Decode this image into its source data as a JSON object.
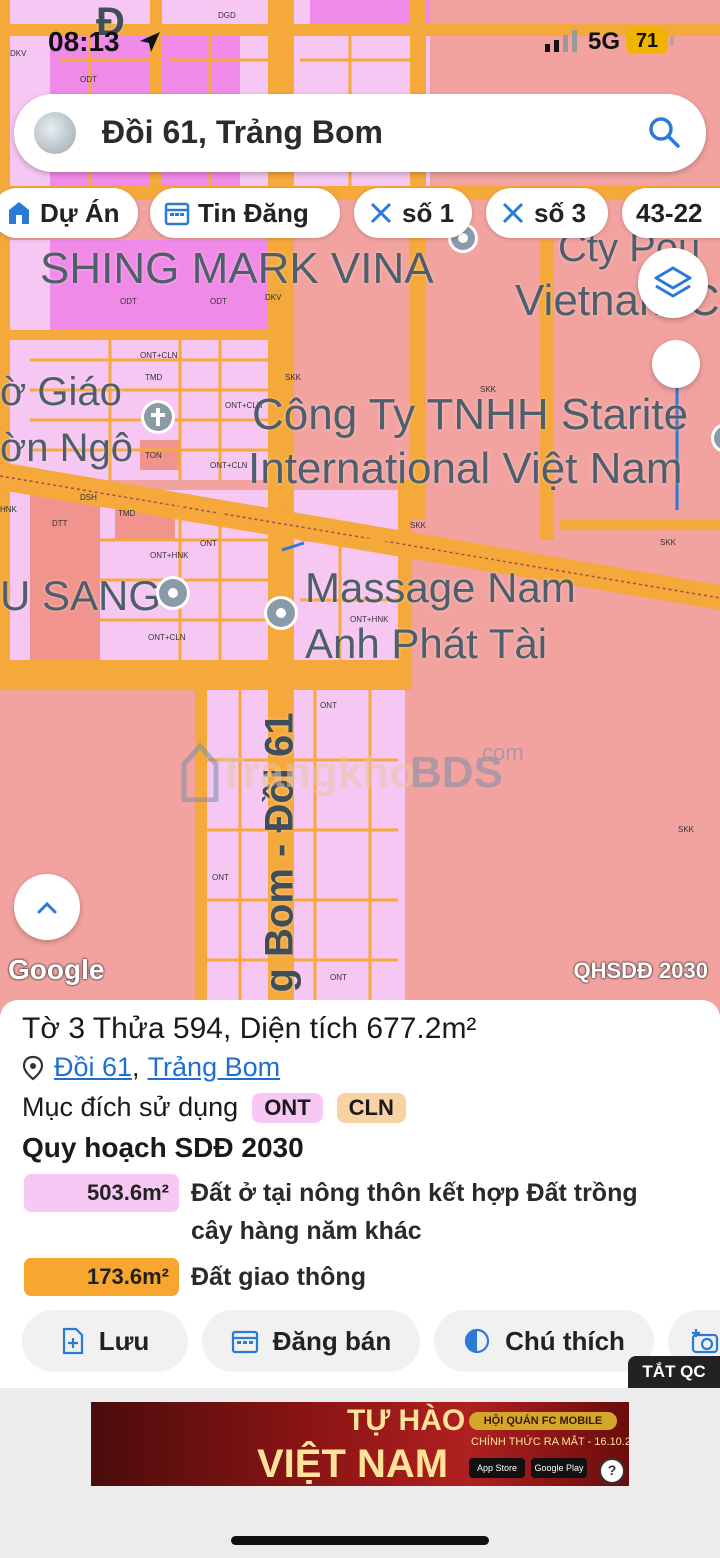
{
  "status_bar": {
    "time": "08:13",
    "network": "5G",
    "battery": "71"
  },
  "search": {
    "query": "Đồi 61, Trảng Bom"
  },
  "chips": [
    "Dự Án",
    "Tin Đăng",
    "số 1",
    "số 3",
    "43-22"
  ],
  "map": {
    "labels": {
      "shing": "SHING MARK VINA",
      "cty_pou": "Cty Pou",
      "vietnam_c": "Vietnam C",
      "giao": "ờ Giáo",
      "ngo": "ờn Ngô",
      "starite1": "Công Ty TNHH Starite",
      "starite2": "International Việt Nam",
      "sang": "U SANG",
      "massage1": "Massage Nam",
      "massage2": "Anh Phát Tài",
      "road": "g Bom - Đồi 61",
      "top_road": "Đ"
    },
    "parcel_codes": [
      "ODT",
      "DGD",
      "DKV",
      "SKK",
      "ONT+CLN",
      "TMD",
      "DVH",
      "DTT",
      "DSH",
      "TON",
      "HNK",
      "ONT",
      "ONT+HNK"
    ],
    "watermark": {
      "text": "Trangkho",
      "bds": "BDS",
      "com": ".com"
    },
    "google": "Google",
    "layer_tag": "QHSDĐ 2030"
  },
  "sheet": {
    "title": "Tờ 3 Thửa 594, Diện tích 677.2m²",
    "location": {
      "district": "Đồi 61",
      "separator": ",",
      "city": "Trảng Bom"
    },
    "purpose_label": "Mục đích sử dụng",
    "badges": [
      "ONT",
      "CLN"
    ],
    "section_title": "Quy hoạch SDĐ 2030",
    "areas": [
      {
        "value": "503.6m²",
        "desc": "Đất ở tại nông thôn kết hợp Đất trồng cây hàng năm khác",
        "color": "#f8c8f4"
      },
      {
        "value": "173.6m²",
        "desc": "Đất giao thông",
        "color": "#f7a630"
      }
    ],
    "actions": [
      "Lưu",
      "Đăng bán",
      "Chú thích"
    ]
  },
  "ad": {
    "toggle": "TẮT QC",
    "small": "HỘI QUÁN FC MOBILE",
    "headline1": "TỰ HÀO",
    "headline2": "VIỆT NAM",
    "tag": "HỘI QUÁN FC MOBILE",
    "date": "CHÍNH THỨC RA MẮT - 16.10.2025",
    "store1": "App Store",
    "store2": "Google Play"
  },
  "colors": {
    "road": "#f5a93a",
    "residential": "#f6c7f2",
    "industrial": "#f2a3a0",
    "purple": "#f08ae8",
    "accent": "#1e6fd0"
  }
}
